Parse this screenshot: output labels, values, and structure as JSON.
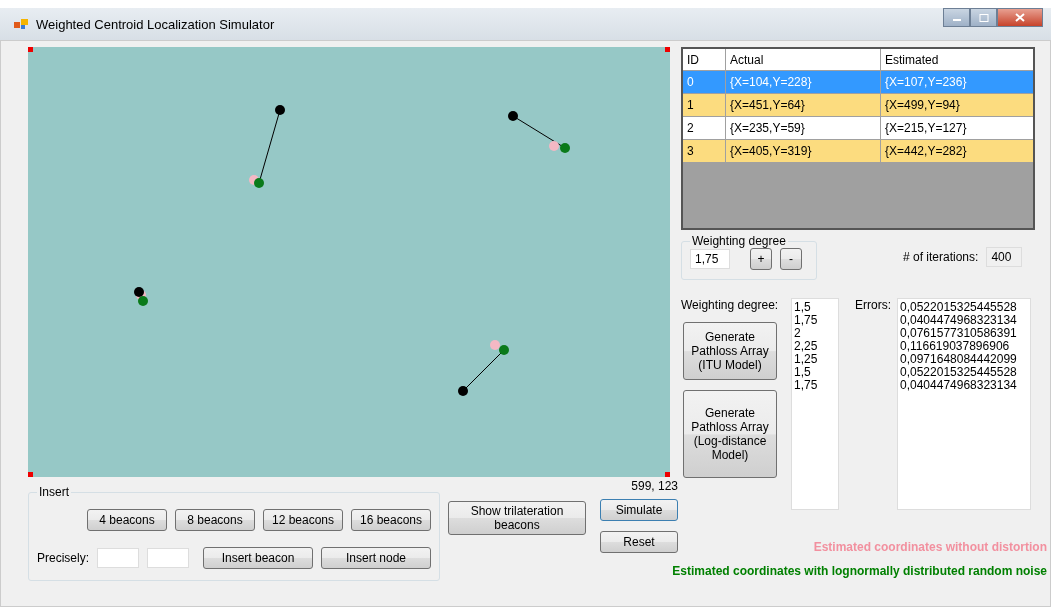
{
  "window": {
    "title": "Weighted Centroid Localization Simulator"
  },
  "table": {
    "columns": [
      "ID",
      "Actual",
      "Estimated"
    ],
    "rows": [
      {
        "id": "0",
        "actual": "{X=104,Y=228}",
        "estimated": "{X=107,Y=236}",
        "selected": true
      },
      {
        "id": "1",
        "actual": "{X=451,Y=64}",
        "estimated": "{X=499,Y=94}",
        "selected": false
      },
      {
        "id": "2",
        "actual": "{X=235,Y=59}",
        "estimated": "{X=215,Y=127}",
        "selected": false
      },
      {
        "id": "3",
        "actual": "{X=405,Y=319}",
        "estimated": "{X=442,Y=282}",
        "selected": false
      }
    ]
  },
  "weighting_group": {
    "title": "Weighting degree",
    "value": "1,75",
    "buttons": [
      "+",
      "-"
    ]
  },
  "iterations": {
    "label": "# of iterations:",
    "value": "400"
  },
  "weighting_list": {
    "label": "Weighting degree:",
    "items": [
      "1,5",
      "1,75",
      "2",
      "2,25",
      "1,25",
      "1,5",
      "1,75"
    ]
  },
  "errors_list": {
    "label": "Errors:",
    "items": [
      "0,0522015325445528",
      "0,0404474968323134",
      "0,0761577310586391",
      "0,116619037896906",
      "0,0971648084442099",
      "0,0522015325445528",
      "0,0404474968323134"
    ]
  },
  "generate_buttons": [
    "Generate Pathloss Array (ITU Model)",
    "Generate Pathloss Array (Log-distance Model)"
  ],
  "coordinate_readout": "599, 123",
  "insert_group": {
    "title": "Insert",
    "beacon_buttons": [
      "4 beacons",
      "8 beacons",
      "12 beacons",
      "16 beacons"
    ],
    "precisely_label": "Precisely:",
    "buttons": [
      "Insert beacon",
      "Insert node"
    ]
  },
  "actions": {
    "trilateration": "Show trilateration beacons",
    "simulate": "Simulate",
    "reset": "Reset"
  },
  "legend": [
    {
      "text": "Estimated coordinates without distortion",
      "color": "#f2909f"
    },
    {
      "text": "Estimated coordinates with lognormally distributed random noise",
      "color": "#008000"
    }
  ]
}
